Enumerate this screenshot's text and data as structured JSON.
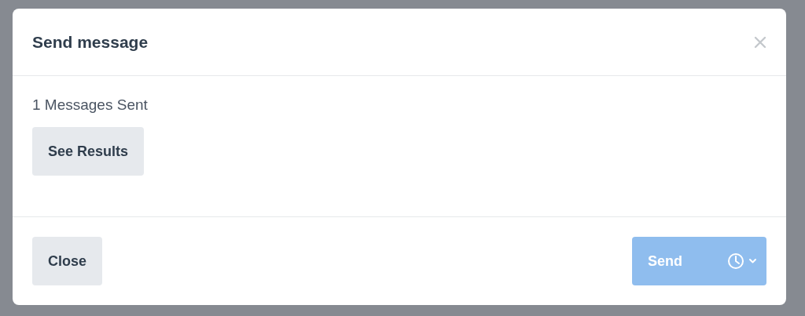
{
  "dialog": {
    "title": "Send message",
    "status": "1 Messages Sent",
    "results_button": "See Results",
    "close_button": "Close",
    "send_button": {
      "label": "Send",
      "disabled": true
    }
  }
}
